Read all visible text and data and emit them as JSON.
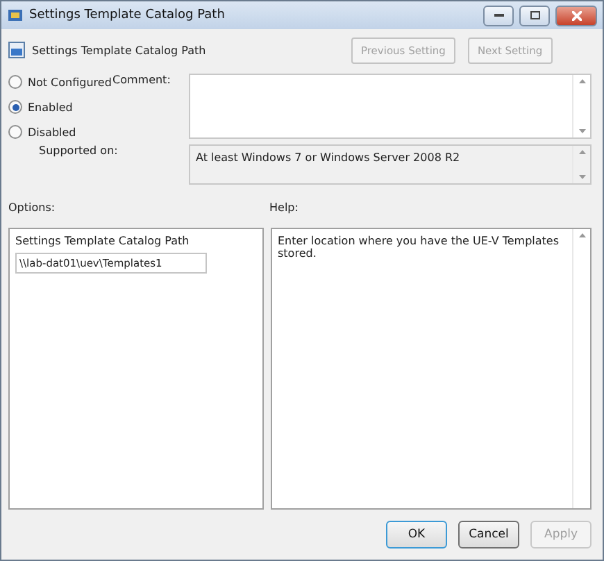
{
  "window": {
    "title": "Settings Template Catalog Path"
  },
  "header": {
    "title": "Settings Template Catalog Path"
  },
  "nav_buttons": [
    {
      "label": "Previous Setting",
      "disabled": true
    },
    {
      "label": "Next Setting",
      "disabled": true
    }
  ],
  "states": [
    {
      "label": "Not Configured",
      "selected": false
    },
    {
      "label": "Enabled",
      "selected": true
    },
    {
      "label": "Disabled",
      "selected": false
    }
  ],
  "comment": {
    "label": "Comment:"
  },
  "supported": {
    "label": "Supported on:",
    "value": "At least Windows 7 or Windows Server 2008 R2"
  },
  "options": {
    "label": "Options:",
    "field_label": "Settings Template Catalog Path",
    "value": "\\\\lab-dat01\\uev\\Templates1"
  },
  "help": {
    "label": "Help:",
    "text": "Enter location where you have the UE-V Templates stored."
  },
  "buttons": [
    {
      "label": "OK",
      "disabled": false,
      "default": true
    },
    {
      "label": "Cancel",
      "disabled": false,
      "default": false
    },
    {
      "label": "Apply",
      "disabled": true,
      "default": false
    }
  ]
}
